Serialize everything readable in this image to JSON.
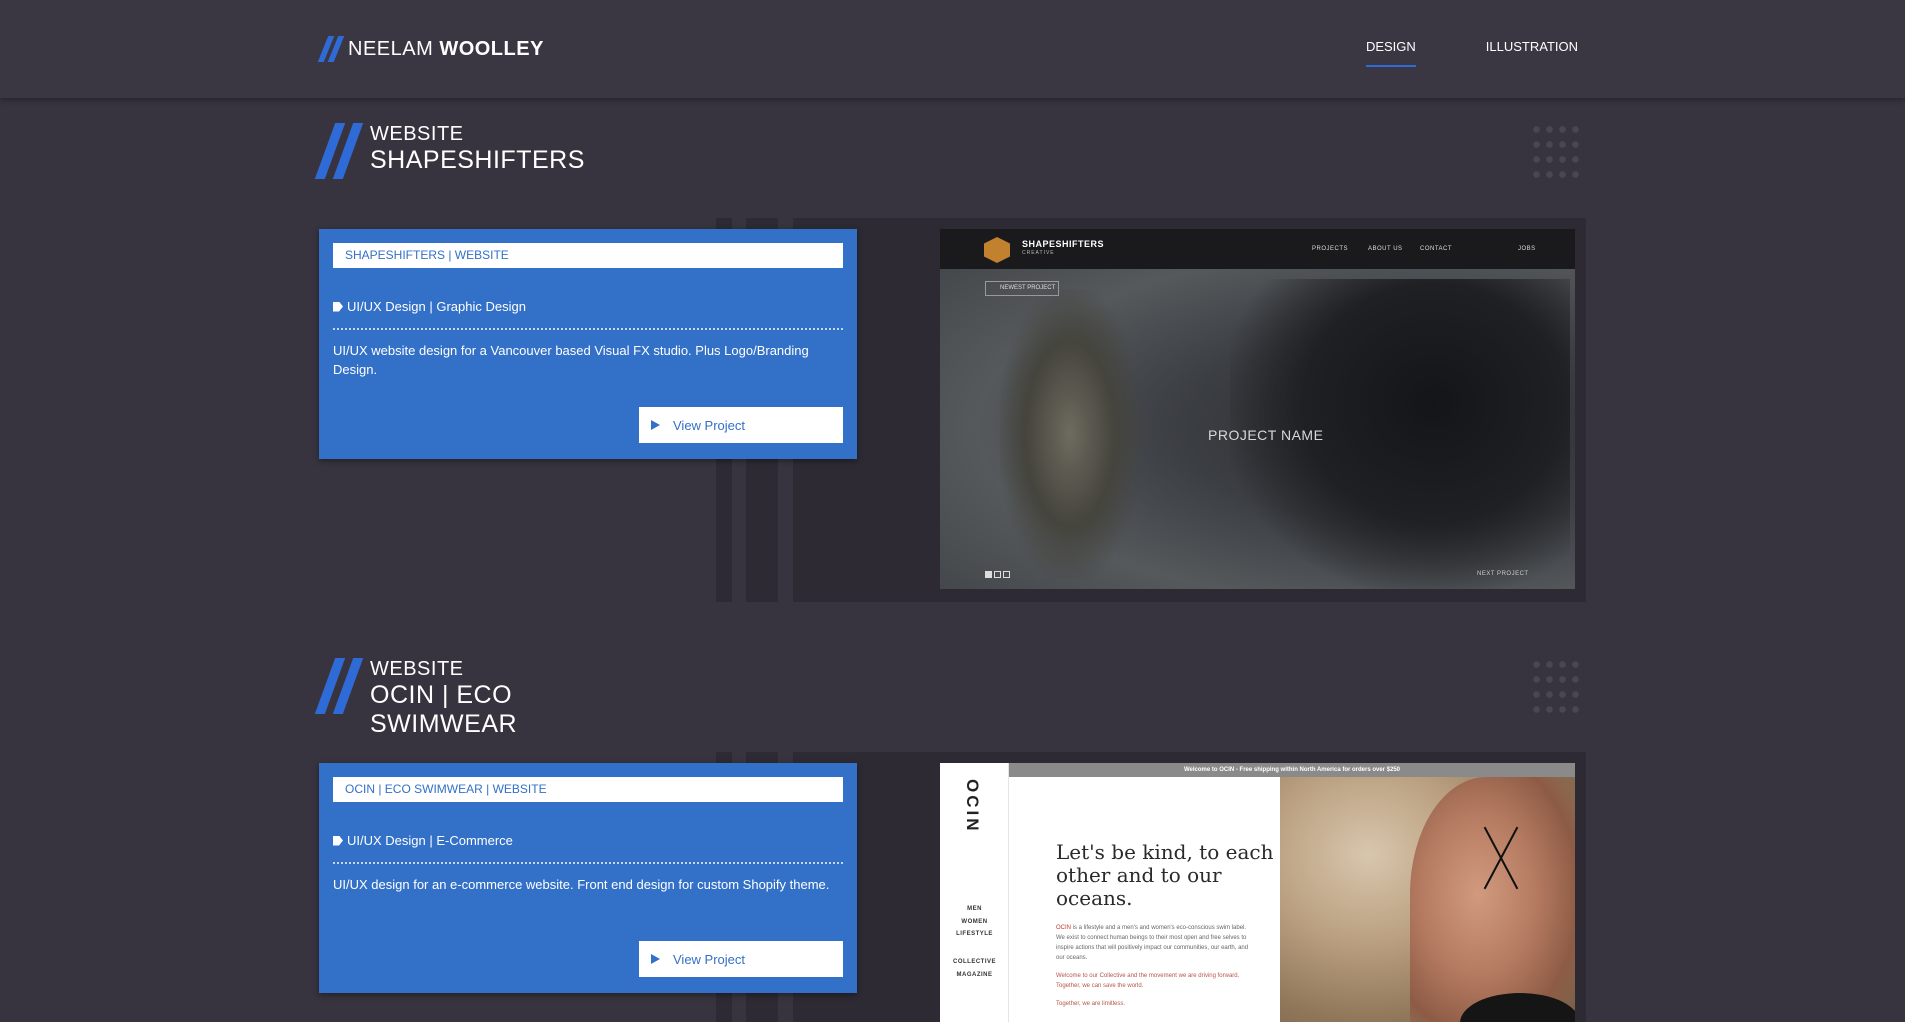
{
  "header": {
    "logo_first": "NEELAM",
    "logo_last": "WOOLLEY",
    "nav": [
      {
        "label": "DESIGN",
        "active": true
      },
      {
        "label": "ILLUSTRATION",
        "active": false
      }
    ]
  },
  "colors": {
    "accent": "#3370c7",
    "background": "#38343f",
    "panel": "#2d2a33"
  },
  "projects": [
    {
      "category": "WEBSITE",
      "name_lines": [
        "SHAPESHIFTERS"
      ],
      "tag": "SHAPESHIFTERS | WEBSITE",
      "disciplines": "UI/UX Design | Graphic Design",
      "description": "UI/UX website design for a Vancouver based Visual FX studio. Plus Logo/Branding Design.",
      "button": "View Project",
      "preview": {
        "brand": "SHAPESHIFTERS",
        "brand_sub": "CREATIVE",
        "nav": [
          "PROJECTS",
          "ABOUT US",
          "CONTACT",
          "JOBS"
        ],
        "button": "NEWEST PROJECT",
        "overlay": "PROJECT NAME",
        "next": "NEXT PROJECT"
      }
    },
    {
      "category": "WEBSITE",
      "name_lines": [
        "OCIN | ECO",
        "SWIMWEAR"
      ],
      "tag": "OCIN | ECO SWIMWEAR | WEBSITE",
      "disciplines": "UI/UX Design | E-Commerce",
      "description": "UI/UX design for an e-commerce website. Front end design for custom Shopify theme.",
      "button": "View Project",
      "preview": {
        "logo": "OCIN",
        "banner": "Welcome to OCIN - Free shipping within North America for orders over $250",
        "menu_top": [
          "MEN",
          "WOMEN",
          "LIFESTYLE"
        ],
        "menu_bottom": [
          "COLLECTIVE",
          "MAGAZINE"
        ],
        "headline": "Let's be kind, to each other and to our oceans.",
        "para1_highlight": "OCIN",
        "para1": " is a lifestyle and a men's and women's eco-conscious swim label. We exist to connect human beings to their most open and free selves to inspire actions that will positively impact our communities, our earth, and our oceans.",
        "para2": "Welcome to our Collective and the movement we are driving forward. Together, we can save the world.",
        "para3": "Together, we are limitless."
      }
    }
  ]
}
